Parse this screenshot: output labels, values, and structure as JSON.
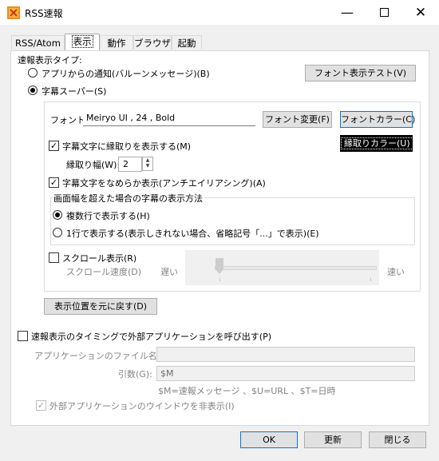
{
  "window": {
    "title": "RSS速報"
  },
  "tabs": [
    {
      "label": "RSS/Atom"
    },
    {
      "label": "表示"
    },
    {
      "label": "動作"
    },
    {
      "label": "ブラウザ"
    },
    {
      "label": "起動"
    }
  ],
  "display": {
    "type_label": "速報表示タイプ:",
    "radio_notify": "アプリからの通知(バルーンメッセージ)(B)",
    "radio_super": "字幕スーパー(S)",
    "font_test_button": "フォント表示テスト(V)",
    "font_label": "フォント:",
    "font_value": "Meiryo UI , 24 , Bold",
    "font_change_button": "フォント変更(F)",
    "font_color_button": "フォントカラー(C)",
    "outline_color_button": "縁取りカラー(U)",
    "outline_check": "字幕文字に縁取りを表示する(M)",
    "outline_width_label": "縁取り幅(W):",
    "outline_width_value": "2",
    "antialias_check": "字幕文字をなめらか表示(アンチエイリアシング)(A)",
    "overflow_group": "画面幅を超えた場合の字幕の表示方法",
    "radio_multiline": "複数行で表示する(H)",
    "radio_singleline": "1行で表示する(表示しきれない場合、省略記号「...」で表示)(E)",
    "scroll_check": "スクロール表示(R)",
    "scroll_speed_label": "スクロール速度(D)",
    "slow_label": "遅い",
    "fast_label": "速い",
    "scroll_speed_level": 0.0,
    "reset_position_button": "表示位置を元に戻す(D)",
    "external_app_check": "速報表示のタイミングで外部アプリケーションを呼び出す(P)",
    "app_file_label": "アプリケーションのファイル名(X):",
    "app_file_value": "",
    "args_label": "引数(G):",
    "args_value": "$M",
    "args_hint": "$M=速報メッセージ 、$U=URL 、$T=日時",
    "hide_window_check": "外部アプリケーションのウインドウを非表示(I)"
  },
  "footer": {
    "ok": "OK",
    "update": "更新",
    "close": "閉じる"
  }
}
